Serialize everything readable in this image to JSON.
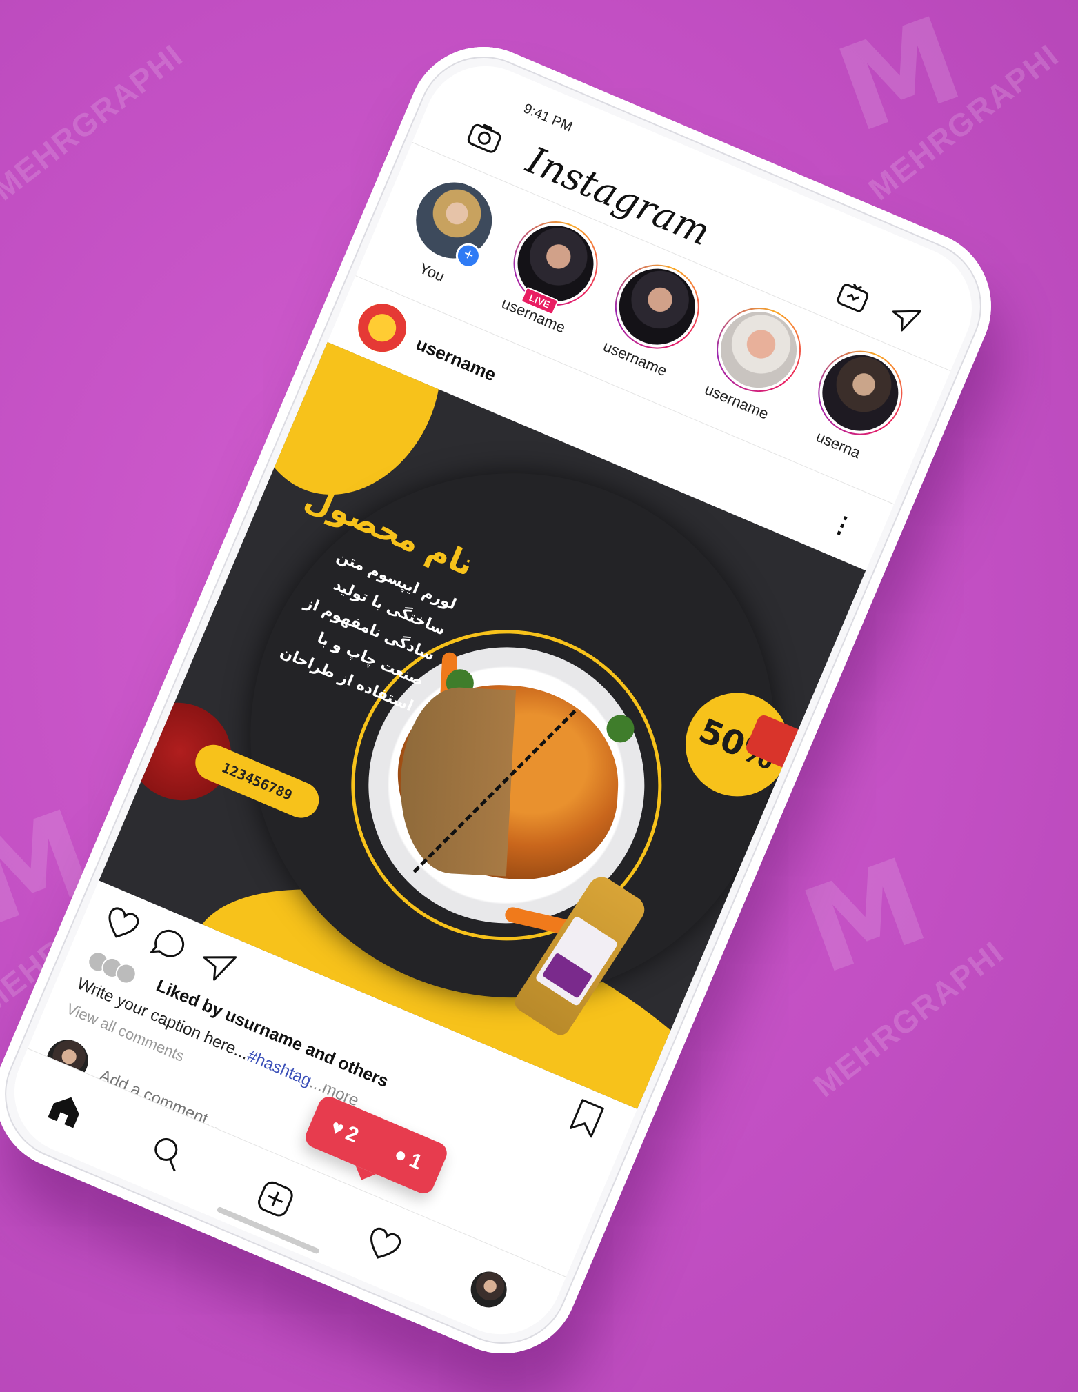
{
  "status_bar": {
    "time": "9:41 PM"
  },
  "app": {
    "title": "Instagram"
  },
  "stories": [
    {
      "label": "You",
      "type": "you"
    },
    {
      "label": "username",
      "type": "live",
      "badge": "LIVE"
    },
    {
      "label": "username",
      "type": "normal"
    },
    {
      "label": "username",
      "type": "normal"
    },
    {
      "label": "userna",
      "type": "normal"
    }
  ],
  "post": {
    "username": "username",
    "image": {
      "product_name": "نام محصول",
      "description_lines": [
        "لورم ایپسوم متن",
        "ساختگی با تولید",
        "سادگی نامفهوم از",
        "صنعت چاپ و با",
        "استفاده از طراحان"
      ],
      "discount": "50%",
      "phone": "123456789"
    },
    "liked_by_prefix": "Liked by",
    "liked_by_user": "usurname",
    "liked_by_suffix": "and others",
    "caption": "Write your caption here...",
    "hashtag": "#hashtag",
    "more": "...more",
    "view_all_comments": "View all comments",
    "add_comment_placeholder": "Add a comment..."
  },
  "notification": {
    "likes": "2",
    "comments": "1"
  },
  "colors": {
    "background": "#c24fc3",
    "accent_yellow": "#f7c21b",
    "post_dark": "#2c2c30",
    "notif_red": "#e73c4e"
  },
  "watermark": "MEHRGRAPHI"
}
